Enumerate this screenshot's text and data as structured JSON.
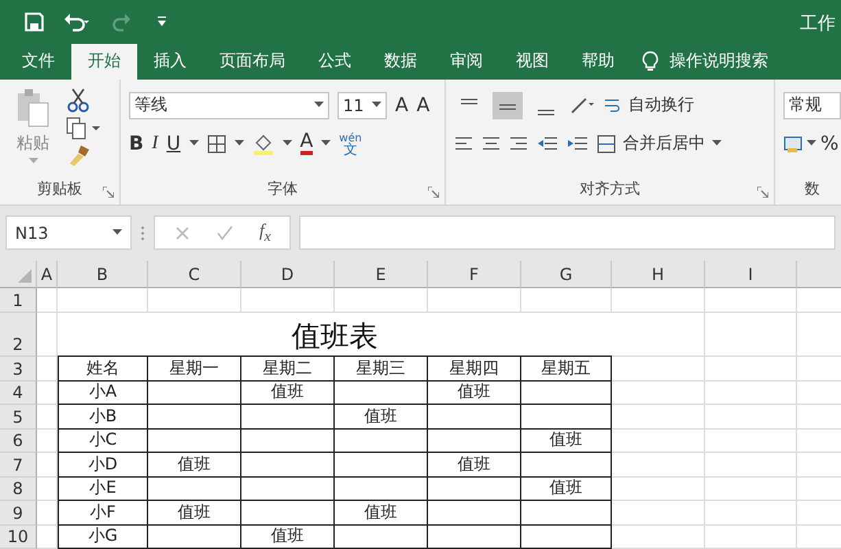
{
  "window": {
    "title": "工作"
  },
  "tabs": [
    {
      "label": "文件",
      "selected": false
    },
    {
      "label": "开始",
      "selected": true
    },
    {
      "label": "插入",
      "selected": false
    },
    {
      "label": "页面布局",
      "selected": false
    },
    {
      "label": "公式",
      "selected": false
    },
    {
      "label": "数据",
      "selected": false
    },
    {
      "label": "审阅",
      "selected": false
    },
    {
      "label": "视图",
      "selected": false
    },
    {
      "label": "帮助",
      "selected": false
    }
  ],
  "search": {
    "label": "操作说明搜索"
  },
  "ribbon": {
    "clipboard": {
      "paste": "粘贴",
      "group": "剪贴板"
    },
    "font": {
      "font_name": "等线",
      "font_size": "11",
      "grow": "A",
      "shrink": "A",
      "bold": "B",
      "italic": "I",
      "underline": "U",
      "font_color": "A",
      "phonetic_top": "wén",
      "phonetic_bottom": "文",
      "group": "字体"
    },
    "alignment": {
      "vertical": [
        {
          "kind": "top",
          "selected": false
        },
        {
          "kind": "middle",
          "selected": true
        },
        {
          "kind": "bottom",
          "selected": false
        }
      ],
      "wrap": "自动换行",
      "merge": "合并后居中",
      "group": "对齐方式"
    },
    "number": {
      "format": "常规",
      "percent": "%",
      "group": "数"
    }
  },
  "formula_bar": {
    "name_box": "N13",
    "fx": "f$_{x}$"
  },
  "sheet": {
    "column_letters": [
      "A",
      "B",
      "C",
      "D",
      "E",
      "F",
      "G",
      "H",
      "I"
    ],
    "title": "值班表",
    "header": [
      "姓名",
      "星期一",
      "星期二",
      "星期三",
      "星期四",
      "星期五"
    ],
    "rows": [
      [
        "小A",
        null,
        "值班",
        null,
        "值班",
        null
      ],
      [
        "小B",
        null,
        null,
        "值班",
        null,
        null
      ],
      [
        "小C",
        null,
        null,
        null,
        null,
        "值班"
      ],
      [
        "小D",
        "值班",
        null,
        null,
        "值班",
        null
      ],
      [
        "小E",
        null,
        null,
        null,
        null,
        "值班"
      ],
      [
        "小F",
        "值班",
        null,
        "值班",
        null,
        null
      ],
      [
        "小G",
        null,
        "值班",
        null,
        null,
        null
      ]
    ],
    "row_numbers": [
      "1",
      "2",
      "3",
      "4",
      "5",
      "6",
      "7",
      "8",
      "9",
      "10"
    ]
  }
}
